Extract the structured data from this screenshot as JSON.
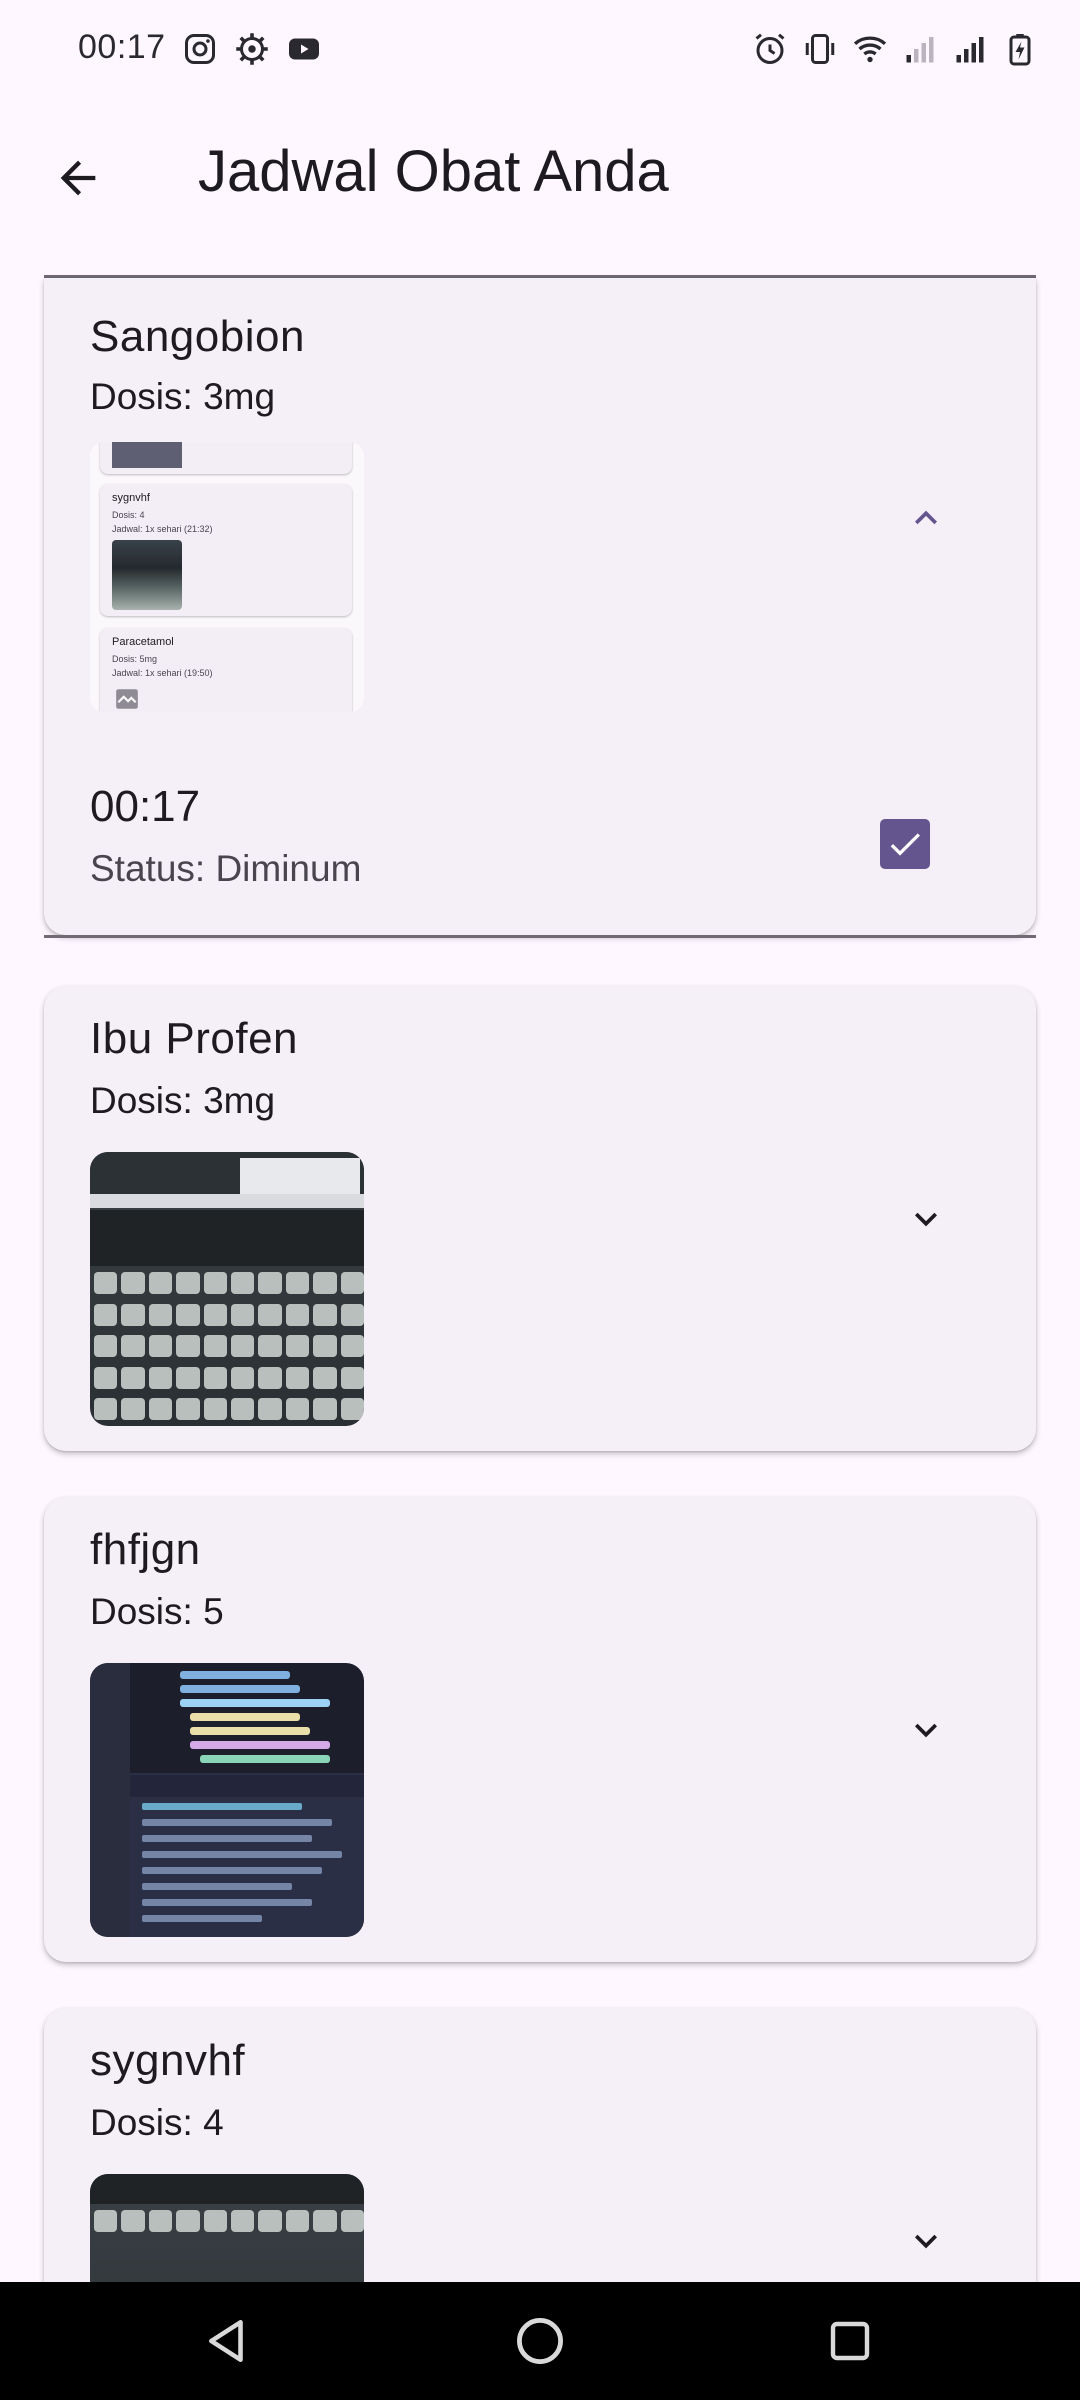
{
  "status_bar": {
    "time": "00:17",
    "left_icons": [
      "instagram-icon",
      "settings-icon",
      "youtube-icon"
    ],
    "right_icons": [
      "alarm-icon",
      "vibrate-icon",
      "wifi-icon",
      "signal-weak-icon",
      "signal-icon",
      "battery-charging-icon"
    ]
  },
  "app_bar": {
    "back_icon": "arrow-back-icon",
    "title": "Jadwal Obat Anda"
  },
  "medicines": [
    {
      "name": "Sangobion",
      "dose": "Dosis: 3mg",
      "expanded": true,
      "chevron": "chevron-up-icon",
      "thumbnail": {
        "type": "screenshot",
        "items": [
          {
            "name": "sygnvhf",
            "dose": "Dosis: 4",
            "schedule": "Jadwal: 1x sehari (21:32)"
          },
          {
            "name": "Paracetamol",
            "dose": "Dosis: 5mg",
            "schedule": "Jadwal: 1x sehari (19:50)"
          }
        ]
      },
      "detail": {
        "time": "00:17",
        "status": "Status: Diminum",
        "checked": true
      }
    },
    {
      "name": "Ibu Profen",
      "dose": "Dosis: 3mg",
      "expanded": false,
      "chevron": "chevron-down-icon",
      "thumbnail": {
        "type": "keyboard-photo"
      }
    },
    {
      "name": "fhfjgn",
      "dose": "Dosis: 5",
      "expanded": false,
      "chevron": "chevron-down-icon",
      "thumbnail": {
        "type": "code-photo"
      }
    },
    {
      "name": "sygnvhf",
      "dose": "Dosis: 4",
      "expanded": false,
      "chevron": "chevron-down-icon",
      "thumbnail": {
        "type": "keyboard-photo"
      }
    }
  ],
  "colors": {
    "background": "#FEF7FF",
    "card": "#F5EFF7",
    "accent": "#65558F",
    "text": "#1D1B20",
    "secondary_text": "#49454F"
  },
  "nav_bar": {
    "back": "nav-back-icon",
    "home": "nav-home-icon",
    "recents": "nav-recents-icon"
  }
}
